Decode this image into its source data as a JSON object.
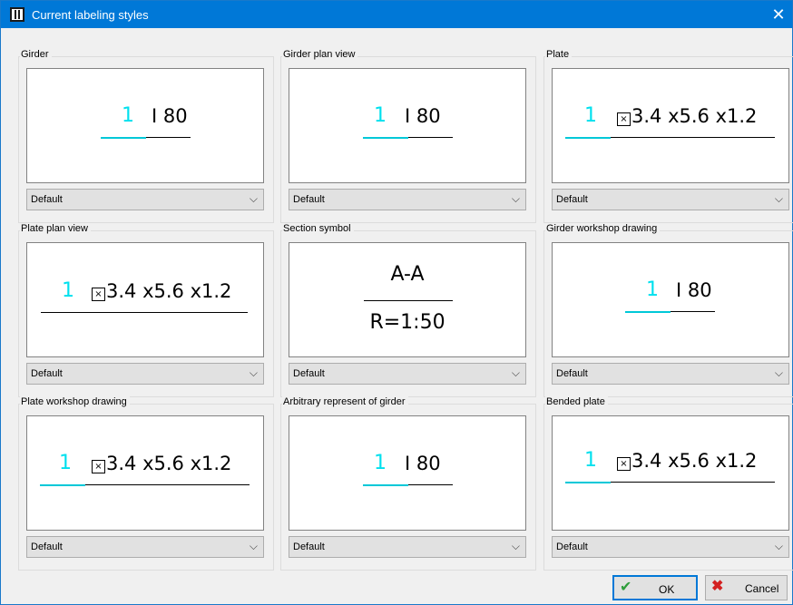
{
  "window": {
    "title": "Current labeling styles",
    "close_icon": "close-icon",
    "app_icon": "app-icon"
  },
  "colors": {
    "titlebar": "#0078d7",
    "label_number": "#00e0ee",
    "underline_accent": "#00c8d8"
  },
  "groups": [
    {
      "label": "Girder",
      "number": "1",
      "profile": "I 80",
      "style": "Default"
    },
    {
      "label": "Girder plan view",
      "number": "1",
      "profile": "I 80",
      "style": "Default"
    },
    {
      "label": "Plate",
      "number": "1",
      "profile": "3.4 x5.6 x1.2",
      "style": "Default"
    },
    {
      "label": "Plate plan view",
      "number": "1",
      "profile": "3.4 x5.6 x1.2",
      "style": "Default"
    },
    {
      "label": "Section symbol",
      "section_top": "A-A",
      "section_bottom": "R=1:50",
      "style": "Default"
    },
    {
      "label": "Girder workshop drawing",
      "number": "1",
      "profile": "I 80",
      "style": "Default"
    },
    {
      "label": "Plate workshop drawing",
      "number": "1",
      "profile": "3.4 x5.6 x1.2",
      "style": "Default"
    },
    {
      "label": "Arbitrary represent of girder",
      "number": "1",
      "profile": "I 80",
      "style": "Default"
    },
    {
      "label": "Bended plate",
      "number": "1",
      "profile": "3.4 x5.6 x1.2",
      "style": "Default"
    }
  ],
  "buttons": {
    "ok_label": "OK",
    "cancel_label": "Cancel"
  }
}
